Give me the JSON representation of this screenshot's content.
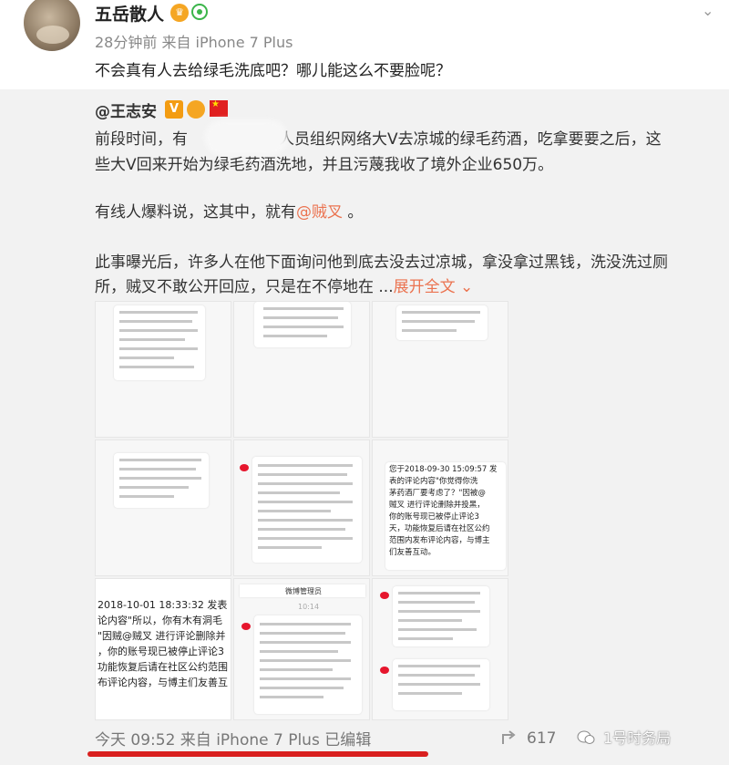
{
  "post": {
    "username": "五岳散人",
    "meta": "28分钟前 来自 iPhone 7 Plus",
    "status": "不会真有人去给绿毛洗底吧？哪儿能这么不要脸呢？"
  },
  "repost": {
    "username": "@王志安",
    "v_badge": "V",
    "lines": [
      [
        "前段时间，有",
        "",
        "人员组织网络大V去凉城的绿毛药酒，吃拿要要之后，这"
      ],
      [
        "些大V回来开始为绿毛药酒洗地，并且污蔑我收了境外企业650万。"
      ],
      [
        "有线人爆料说，这其中，就有",
        "@贼叉",
        " 。"
      ],
      [
        "此事曝光后，许多人在他下面询问他到底去没去过凉城，拿没拿过黑钱，洗没洗过厕"
      ],
      [
        "所，贼叉不敢公开回应，只是在不停地在 ...",
        "展开全文",
        " ⌄"
      ]
    ]
  },
  "grid_texts": {
    "cell7_lines": [
      "2018-10-01 18:33:32 发表",
      "论内容\"所以，你有木有洞毛",
      "\"因贼@贼叉 进行评论删除并",
      "，你的账号现已被停止评论3",
      "功能恢复后请在社区公约范围",
      "布评论内容，与博主们友善互"
    ],
    "cell6_lines": [
      "您于2018-09-30 15:09:57 发",
      "表的评论内容\"你觉得你洗",
      "茅药酒厂要考虑了？\"因被@",
      "贼叉 进行评论删除并投黑，",
      "你的账号现已被停止评论3",
      "天，功能恢复后请在社区公约",
      "范围内发布评论内容，与博主",
      "们友善互动。"
    ],
    "cell8_title": "微博管理员",
    "cell8_time": "10:14"
  },
  "footer": {
    "time": "今天 09:52 来自 iPhone 7 Plus  已编辑",
    "share_count": "617",
    "watermark": "1号时务局"
  }
}
